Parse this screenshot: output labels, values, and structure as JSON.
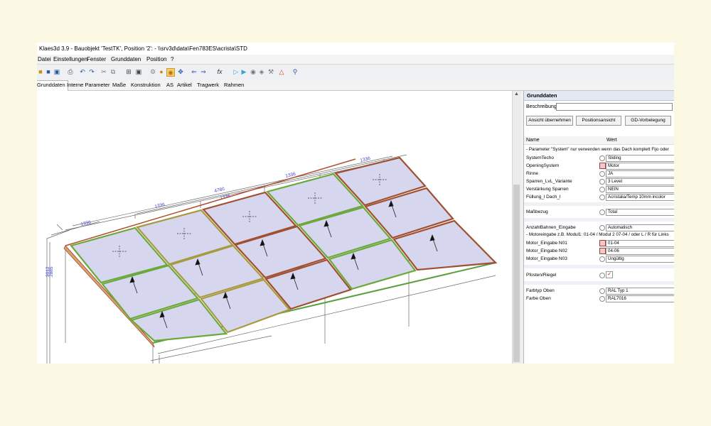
{
  "window": {
    "title": "Klaes3d 3.9 - Bauobjekt 'TestTK', Position '2':  - \\\\srv3d\\data\\Fen783ES\\acrista\\STD"
  },
  "menu": [
    "Datei",
    "Einstellungen",
    "Fenster",
    "Grunddaten",
    "Position",
    "?"
  ],
  "toolbar_icons": [
    "open-icon",
    "save-icon",
    "save-all-icon",
    "print-icon",
    "undo-icon",
    "redo-icon",
    "cut-icon",
    "copy-icon",
    "grid-icon",
    "select-icon",
    "tool-icon",
    "tool2-icon",
    "tool3-icon",
    "move-icon",
    "back-icon",
    "forward-icon",
    "function-icon",
    "play-icon",
    "play2-icon",
    "render-icon",
    "shape-icon",
    "tool4-icon",
    "warning-icon",
    "zoom-icon"
  ],
  "tabs": [
    "Grunddaten",
    "Interne Parameter",
    "Maße",
    "Konstruktion",
    "AS",
    "Artikel",
    "Tragwerk",
    "Rahmen"
  ],
  "active_tab": "Grunddaten",
  "drawing": {
    "dim_total": "4780",
    "dim_top_segment": "1336",
    "dim_top_segment_b": "1336",
    "dim_row1": "1336",
    "dim_row2": "1336",
    "dim_row3": "1336",
    "dim_left": "1336",
    "dim_height_a": "3012",
    "dim_height_b": "2885"
  },
  "panel": {
    "title": "Grunddaten",
    "beschreibung_label": "Beschreibung:",
    "beschreibung_value": "",
    "buttons": [
      "Ansicht übernehmen",
      "Positionsansicht",
      "GD-Vorbelegung"
    ],
    "col_name": "Name",
    "col_value": "Wert",
    "note_system": "- Parameter \"System\" nur verwenden wenn das Dach komplett Fijo oder",
    "rows_a": [
      {
        "name": "SystemTecho",
        "value": "Sliding",
        "icon": "radio"
      },
      {
        "name": "OpeningSystem",
        "value": "Motor",
        "icon": "red"
      },
      {
        "name": "Rinne",
        "value": "JA",
        "icon": "radio"
      },
      {
        "name": "Sparren_LvL_Variante",
        "value": "3 Level",
        "icon": "radio"
      },
      {
        "name": "Verstärkung Sparren",
        "value": "NEIN",
        "icon": "radio"
      },
      {
        "name": "Füllung_l Dach_l",
        "value": "Acristalia/Temp 10mm incolor",
        "icon": "radio"
      }
    ],
    "row_massbezug": {
      "name": "Maßbezug",
      "value": "Total",
      "icon": "radio"
    },
    "row_anzahl": {
      "name": "AnzahlBahnen_Eingabe",
      "value": "Automatisch",
      "icon": "radio"
    },
    "note_motor": "- Motoreingabe z.B. Modul1: 01-04 / Modul 2 07-04 / oder L / R für Links",
    "rows_motor": [
      {
        "name": "Motor_Eingabe N01",
        "value": "01-04",
        "icon": "red"
      },
      {
        "name": "Motor_Eingabe N02",
        "value": "04-06",
        "icon": "red"
      },
      {
        "name": "Motor_Eingabe N03",
        "value": "Ungültig",
        "icon": "radio"
      }
    ],
    "row_pfosten": {
      "name": "Pfosten/Riegel",
      "value": "",
      "icon": "radio"
    },
    "rows_farbe": [
      {
        "name": "Farbtyp Oben",
        "value": "RAL Typ 1",
        "icon": "radio"
      },
      {
        "name": "Farbe Oben",
        "value": "RAL7016",
        "icon": "radio"
      }
    ]
  }
}
